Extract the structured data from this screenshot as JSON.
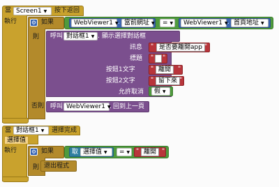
{
  "block1": {
    "when": "當",
    "component": "Screen1",
    "event": "按下返回",
    "do": "執行",
    "if": "如果",
    "then": "則",
    "else": "否則",
    "compare_left_component": "WebViewer1",
    "compare_left_prop": "當前網址",
    "compare_op": "=",
    "compare_right_component": "WebViewer1",
    "compare_right_prop": "首頁地址",
    "call": "呼叫",
    "dialog_component": "對話框1",
    "dialog_method": "顯示選擇對話框",
    "params": [
      {
        "label": "訊息",
        "value": "是否要離開app"
      },
      {
        "label": "標題",
        "value": ""
      },
      {
        "label": "按鈕1文字",
        "value": "離開"
      },
      {
        "label": "按鈕2文字",
        "value": "留下來"
      },
      {
        "label": "允許取消",
        "value": "假"
      }
    ],
    "else_call": "呼叫",
    "else_component": "WebViewer1",
    "else_method": "回到上一頁"
  },
  "block2": {
    "when": "當",
    "component": "對話框1",
    "event": "選擇完成",
    "param": "選擇值",
    "do": "執行",
    "if": "如果",
    "then": "則",
    "get": "取",
    "get_var": "選擇值",
    "compare_op": "=",
    "compare_value": "離開",
    "action": "退出程式"
  },
  "colors": {
    "event": "#c9a22d",
    "control": "#b38a2b",
    "component": "#3e67b0",
    "logic": "#4f9a3d",
    "procedure": "#7b4f8e",
    "text": "#b8353b"
  },
  "icons": [
    "gear-icon",
    "dropdown-arrow-icon"
  ]
}
